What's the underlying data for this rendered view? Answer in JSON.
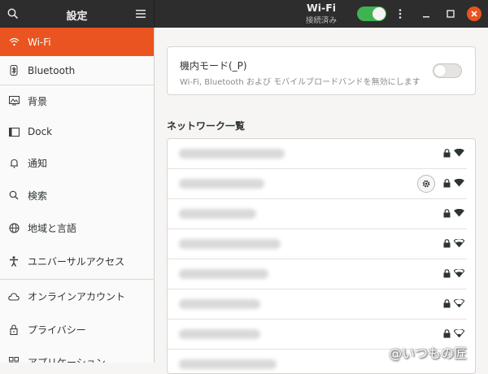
{
  "header": {
    "settings_title": "設定",
    "wifi_title": "Wi-Fi",
    "wifi_subtitle": "接続済み",
    "wifi_enabled": true
  },
  "sidebar": {
    "items": [
      {
        "label": "Wi-Fi",
        "icon": "wifi-icon",
        "active": true
      },
      {
        "label": "Bluetooth",
        "icon": "bluetooth-icon"
      },
      {
        "label": "背景",
        "icon": "background-icon"
      },
      {
        "label": "Dock",
        "icon": "dock-icon"
      },
      {
        "label": "通知",
        "icon": "bell-icon"
      },
      {
        "label": "検索",
        "icon": "search-icon"
      },
      {
        "label": "地域と言語",
        "icon": "globe-icon"
      },
      {
        "label": "ユニバーサルアクセス",
        "icon": "accessibility-icon"
      },
      {
        "label": "オンラインアカウント",
        "icon": "cloud-icon"
      },
      {
        "label": "プライバシー",
        "icon": "lock-icon"
      },
      {
        "label": "アプリケーション",
        "icon": "apps-icon"
      }
    ]
  },
  "airplane": {
    "title": "機内モード(_P)",
    "description": "Wi-Fi, Bluetooth および モバイルブロードバンドを無効にします",
    "enabled": false
  },
  "networks": {
    "heading": "ネットワーク一覧",
    "rows": [
      {
        "signal": "full",
        "secured": true,
        "connected": false
      },
      {
        "signal": "full",
        "secured": true,
        "connected": true
      },
      {
        "signal": "full",
        "secured": true,
        "connected": false
      },
      {
        "signal": "good",
        "secured": true,
        "connected": false
      },
      {
        "signal": "good",
        "secured": true,
        "connected": false
      },
      {
        "signal": "ok",
        "secured": true,
        "connected": false
      },
      {
        "signal": "ok",
        "secured": true,
        "connected": false
      }
    ]
  },
  "watermark": "@いつもの匠",
  "colors": {
    "accent": "#e95420",
    "switch_on": "#3eb34f",
    "headerbar": "#2d2d2d"
  }
}
